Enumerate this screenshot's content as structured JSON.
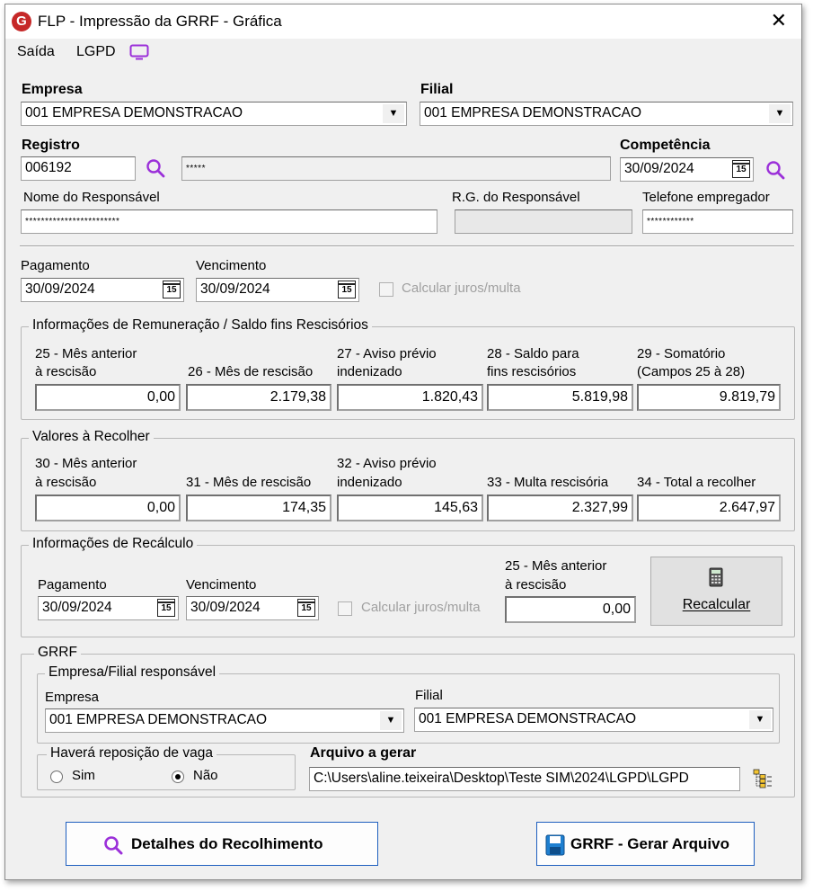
{
  "window": {
    "title": "FLP - Impressão da GRRF - Gráfica",
    "logo_letter": "G"
  },
  "menu": {
    "saida": "Saída",
    "lgpd": "LGPD"
  },
  "empresa": {
    "label": "Empresa",
    "value": "001 EMPRESA DEMONSTRACAO"
  },
  "filial": {
    "label": "Filial",
    "value": "001 EMPRESA DEMONSTRACAO"
  },
  "registro": {
    "label": "Registro",
    "value": "006192",
    "name": "*****"
  },
  "competencia": {
    "label": "Competência",
    "value": "30/09/2024"
  },
  "responsavel": {
    "nome_label": "Nome do Responsável",
    "nome_value": "************************",
    "rg_label": "R.G. do Responsável",
    "rg_value": "",
    "tel_label": "Telefone empregador",
    "tel_value": "************"
  },
  "pagamento": {
    "label": "Pagamento",
    "value": "30/09/2024"
  },
  "vencimento": {
    "label": "Vencimento",
    "value": "30/09/2024"
  },
  "calcular_juros": {
    "label": "Calcular juros/multa"
  },
  "calendar_glyph": "15",
  "remuneracao": {
    "title": "Informações de Remuneração / Saldo fins Rescisórios",
    "fields": [
      {
        "label1": "25 - Mês anterior",
        "label2": "à rescisão",
        "value": "0,00"
      },
      {
        "label1": "",
        "label2": "26 - Mês de rescisão",
        "value": "2.179,38"
      },
      {
        "label1": "27 - Aviso prévio",
        "label2": "indenizado",
        "value": "1.820,43"
      },
      {
        "label1": "28 - Saldo para",
        "label2": "fins rescisórios",
        "value": "5.819,98"
      },
      {
        "label1": "29 - Somatório",
        "label2": "(Campos 25 à 28)",
        "value": "9.819,79"
      }
    ]
  },
  "recolher": {
    "title": "Valores à Recolher",
    "fields": [
      {
        "label1": "30 - Mês anterior",
        "label2": "à rescisão",
        "value": "0,00"
      },
      {
        "label1": "",
        "label2": "31 - Mês de rescisão",
        "value": "174,35"
      },
      {
        "label1": "32 - Aviso prévio",
        "label2": "indenizado",
        "value": "145,63"
      },
      {
        "label1": "",
        "label2": "33 - Multa rescisória",
        "value": "2.327,99"
      },
      {
        "label1": "",
        "label2": "34 - Total a recolher",
        "value": "2.647,97"
      }
    ]
  },
  "recalculo": {
    "title": "Informações de Recálculo",
    "pagamento_label": "Pagamento",
    "pagamento_value": "30/09/2024",
    "vencimento_label": "Vencimento",
    "vencimento_value": "30/09/2024",
    "juros_label": "Calcular juros/multa",
    "mes_label1": "25 - Mês anterior",
    "mes_label2": "à rescisão",
    "mes_value": "0,00",
    "button": "Recalcular"
  },
  "grrf": {
    "title": "GRRF",
    "resp_title": "Empresa/Filial responsável",
    "empresa_label": "Empresa",
    "empresa_value": "001 EMPRESA DEMONSTRACAO",
    "filial_label": "Filial",
    "filial_value": "001 EMPRESA DEMONSTRACAO",
    "vaga_title": "Haverá reposição de vaga",
    "sim": "Sim",
    "nao": "Não",
    "selected": "Não",
    "arquivo_label": "Arquivo a gerar",
    "arquivo_value": "C:\\Users\\aline.teixeira\\Desktop\\Teste SIM\\2024\\LGPD\\LGPD"
  },
  "buttons": {
    "detalhes": "Detalhes do Recolhimento",
    "gerar": "GRRF - Gerar Arquivo"
  },
  "colors": {
    "accent_purple": "#9b30d9",
    "button_border": "#1e5fbf",
    "logo_red": "#c62828"
  }
}
